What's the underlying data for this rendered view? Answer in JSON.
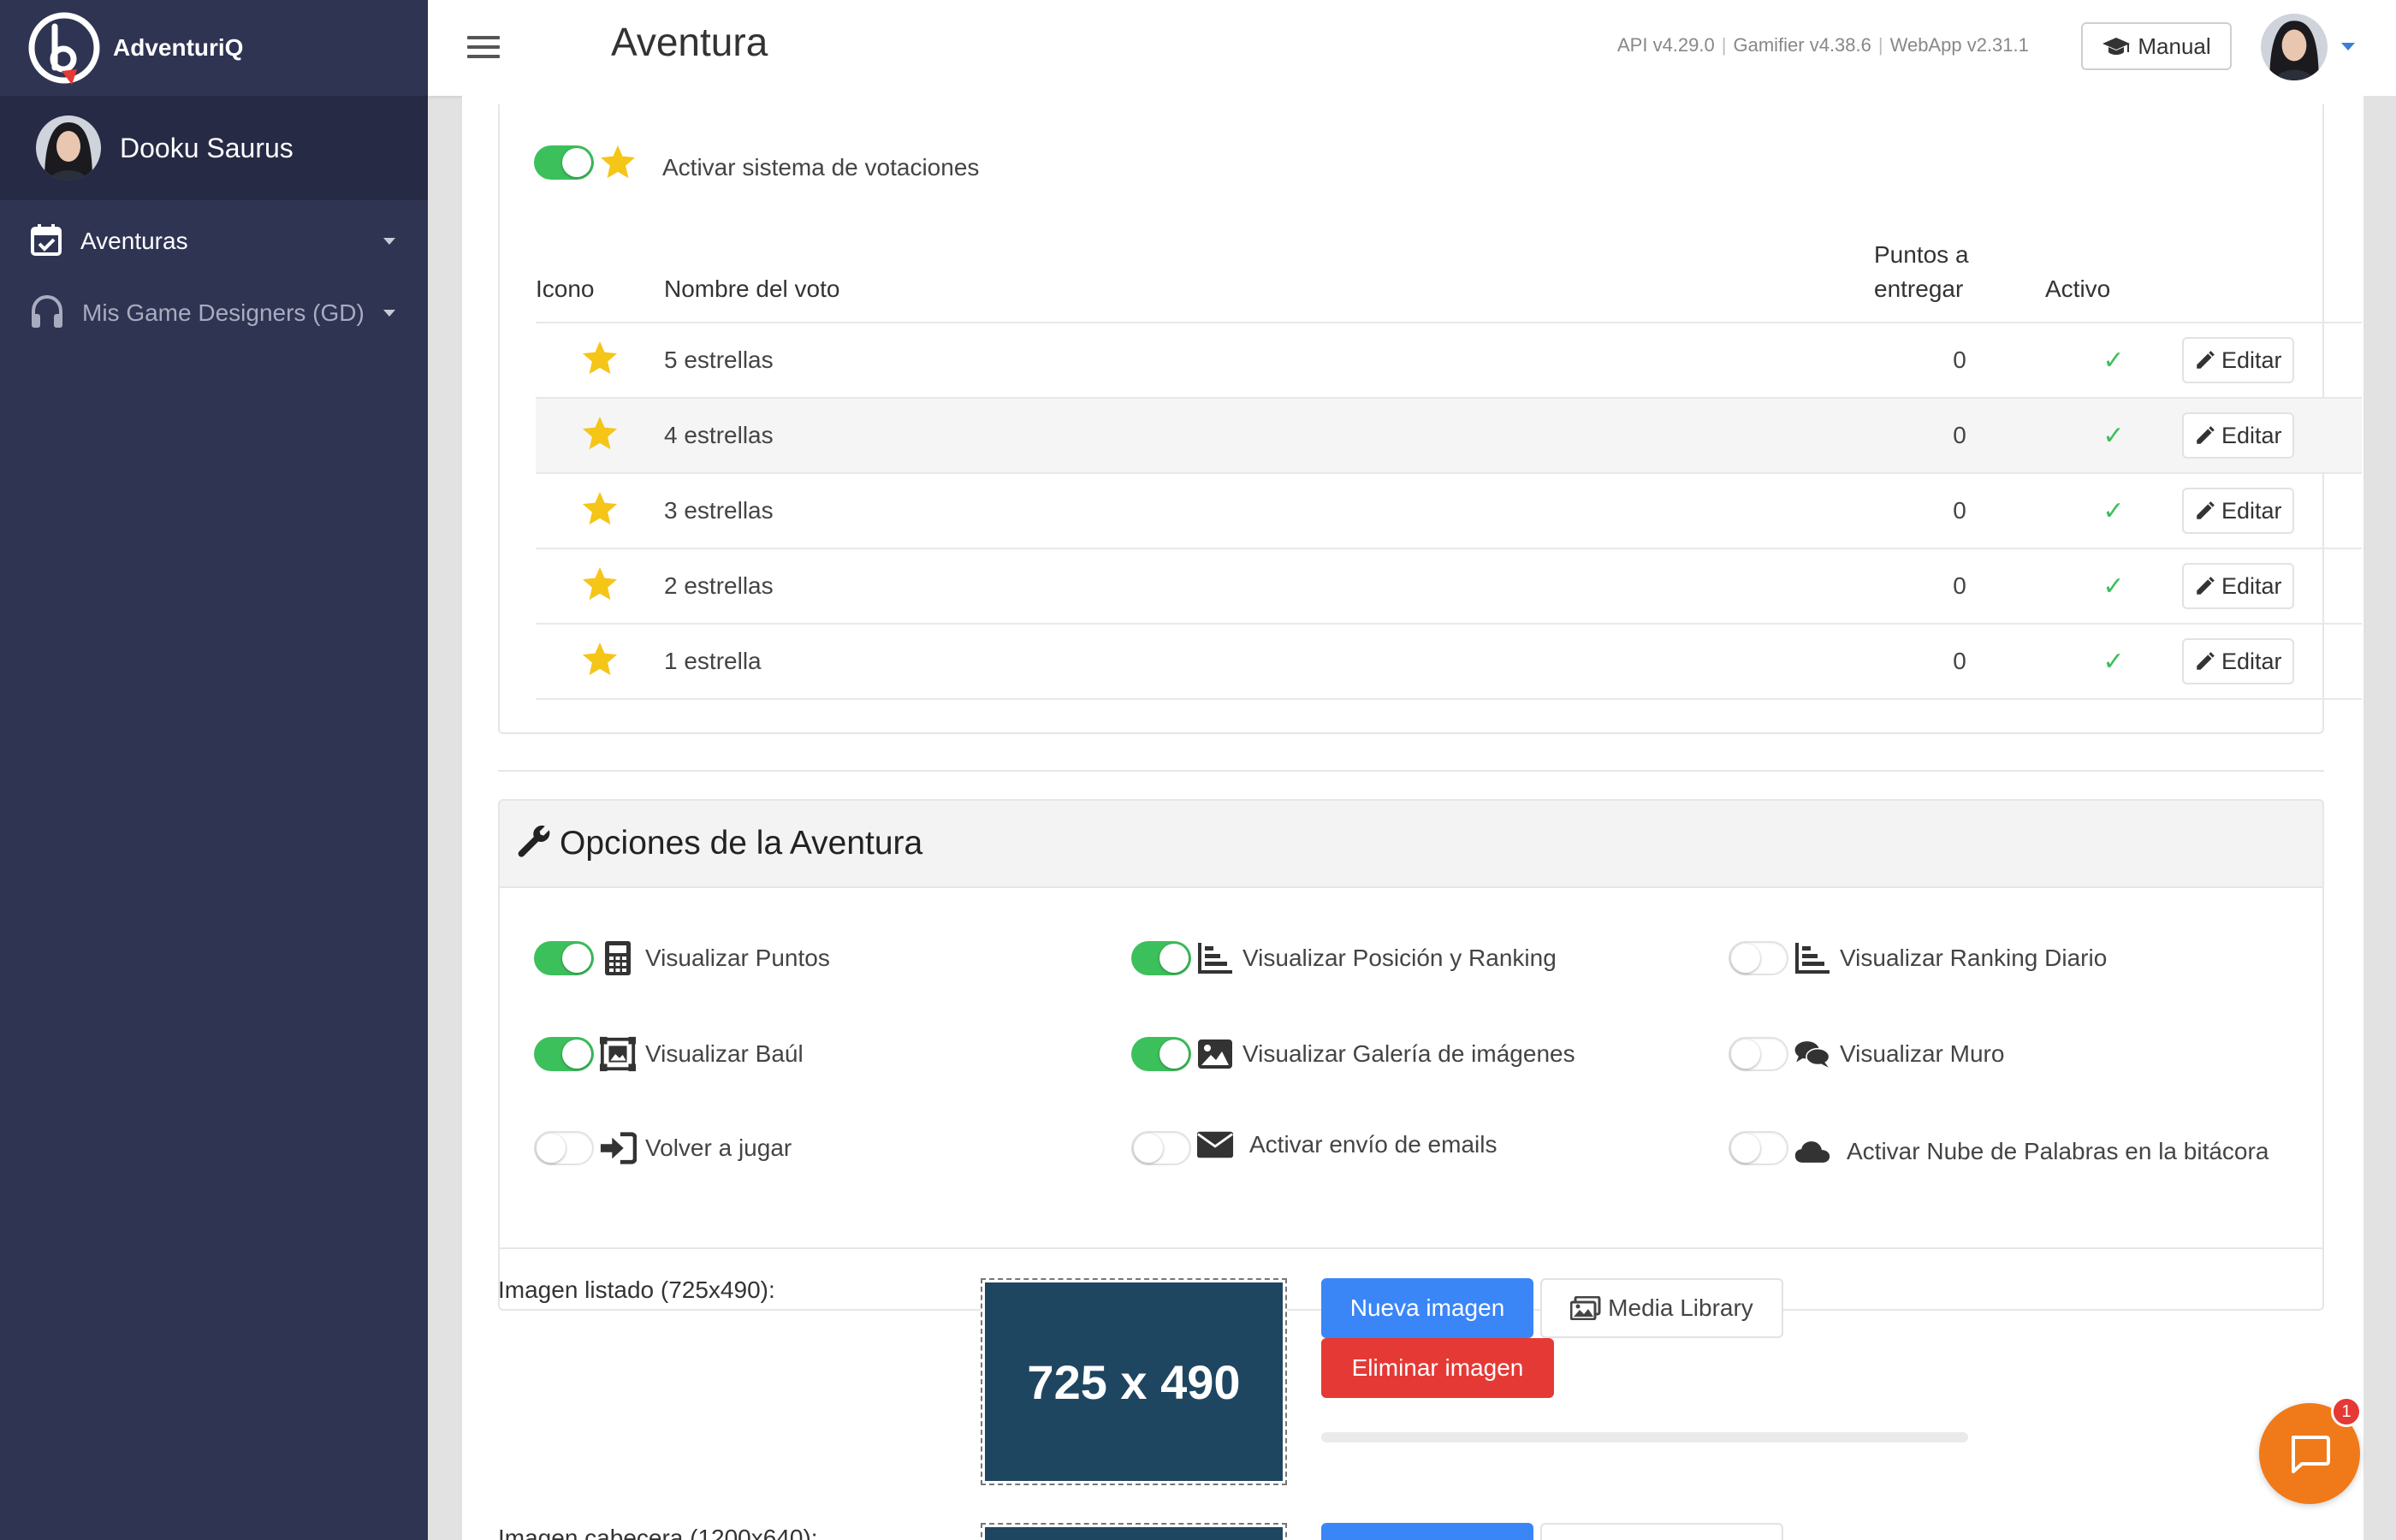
{
  "app": {
    "brand": "AdventuriQ",
    "page_title": "Aventura",
    "versions": [
      "API v4.29.0",
      "Gamifier v4.38.6",
      "WebApp v2.31.1"
    ],
    "manual_label": "Manual"
  },
  "sidebar": {
    "user_name": "Dooku Saurus",
    "items": [
      {
        "label": "Aventuras",
        "icon": "calendar-check-icon"
      },
      {
        "label": "Mis Game Designers (GD)",
        "icon": "headphones-icon"
      }
    ]
  },
  "votes": {
    "toggle_label": "Activar sistema de votaciones",
    "toggle_on": true,
    "columns": {
      "icon": "Icono",
      "name": "Nombre del voto",
      "points_line1": "Puntos a",
      "points_line2": "entregar",
      "active": "Activo"
    },
    "edit_label": "Editar",
    "rows": [
      {
        "name": "5 estrellas",
        "points": "0",
        "active": true
      },
      {
        "name": "4 estrellas",
        "points": "0",
        "active": true
      },
      {
        "name": "3 estrellas",
        "points": "0",
        "active": true
      },
      {
        "name": "2 estrellas",
        "points": "0",
        "active": true
      },
      {
        "name": "1 estrella",
        "points": "0",
        "active": true
      }
    ]
  },
  "options": {
    "title": "Opciones de la Aventura",
    "items": [
      {
        "label": "Visualizar Puntos",
        "on": true,
        "icon": "calculator-icon"
      },
      {
        "label": "Visualizar Posición y Ranking",
        "on": true,
        "icon": "bar-chart-icon"
      },
      {
        "label": "Visualizar Ranking Diario",
        "on": false,
        "icon": "bar-chart-icon"
      },
      {
        "label": "Visualizar Baúl",
        "on": true,
        "icon": "chest-icon"
      },
      {
        "label": "Visualizar Galería de imágenes",
        "on": true,
        "icon": "image-icon"
      },
      {
        "label": "Visualizar Muro",
        "on": false,
        "icon": "comments-icon"
      },
      {
        "label": "Volver a jugar",
        "on": false,
        "icon": "sign-in-icon"
      },
      {
        "label": "Activar envío de emails",
        "on": false,
        "icon": "envelope-icon"
      },
      {
        "label": "Activar Nube de Palabras en la bitácora",
        "on": false,
        "icon": "cloud-icon"
      }
    ]
  },
  "images": {
    "listado_label": "Imagen listado (725x490):",
    "listado_preview": "725 x 490",
    "cabecera_label": "Imagen cabecera (1200x640):",
    "new_image": "Nueva imagen",
    "media_library": "Media Library",
    "delete_image": "Eliminar imagen"
  },
  "chat": {
    "badge": "1"
  },
  "colors": {
    "sidebar": "#2f3453",
    "toggle_on": "#3cc05b",
    "primary": "#3b86f7",
    "danger": "#e53935",
    "star": "#f5c518",
    "chat": "#f07a1a"
  }
}
